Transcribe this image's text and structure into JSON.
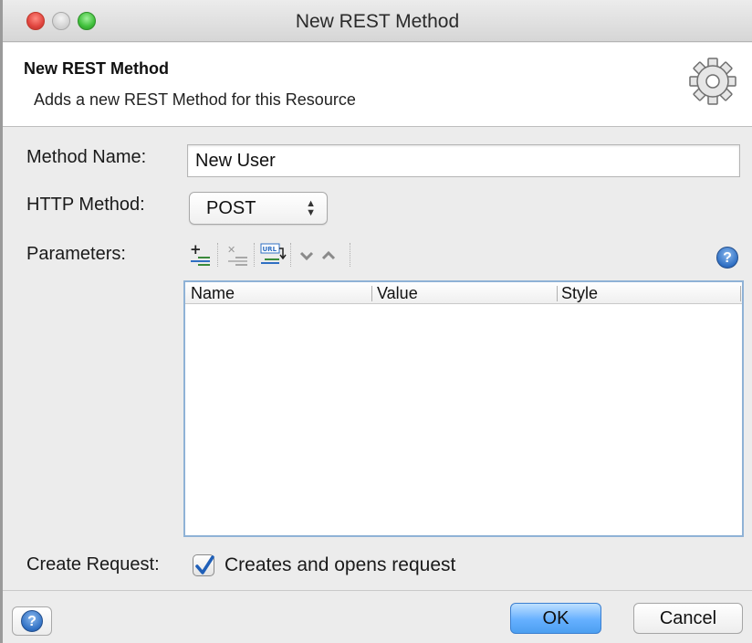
{
  "window": {
    "title": "New REST Method"
  },
  "header": {
    "title": "New REST Method",
    "description": "Adds a new REST Method for this Resource"
  },
  "form": {
    "method_name_label": "Method Name:",
    "method_name_value": "New User",
    "http_method_label": "HTTP Method:",
    "http_method_value": "POST",
    "parameters_label": "Parameters:",
    "create_request_label": "Create Request:",
    "create_request_checkbox_label": "Creates and opens request",
    "create_request_checked": true
  },
  "parameters_toolbar": {
    "icons": [
      "add-parameter-icon",
      "remove-parameter-icon",
      "extract-url-parameters-icon",
      "move-down-icon",
      "move-up-icon",
      "help-icon"
    ],
    "url_glyph_text": "URL"
  },
  "parameters_table": {
    "columns": [
      "Name",
      "Value",
      "Style"
    ],
    "rows": []
  },
  "footer": {
    "ok_label": "OK",
    "cancel_label": "Cancel"
  },
  "colors": {
    "ok_button": "#66b0ff",
    "help_icon": "#2f6fc3",
    "table_border": "#8fb2d6"
  }
}
